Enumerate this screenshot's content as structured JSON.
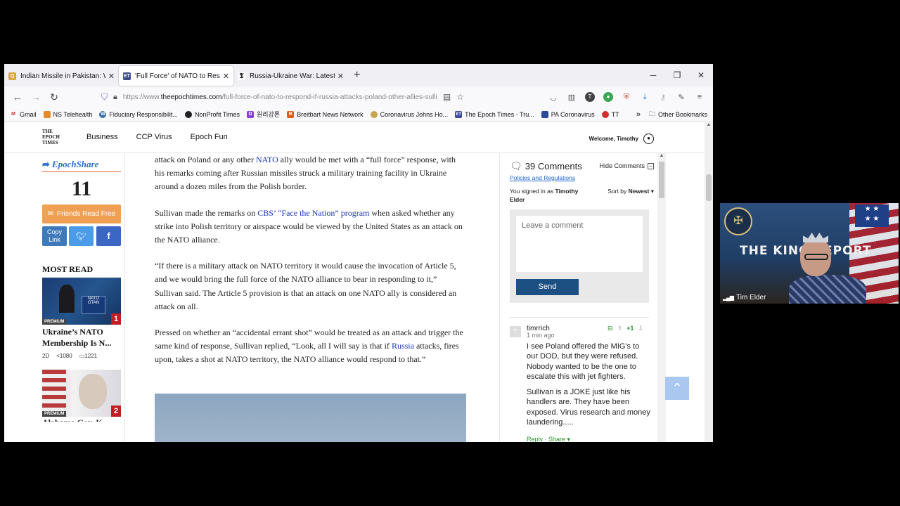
{
  "tabs": [
    {
      "title": "Indian Missile in Pakistan: What",
      "favicon_color": "#d9a441",
      "active": false
    },
    {
      "title": "'Full Force' of NATO to Respond",
      "favicon_color": "#3d4a9a",
      "active": true
    },
    {
      "title": "Russia-Ukraine War: Latest New",
      "favicon_color": "#222222",
      "active": false
    }
  ],
  "toolbar": {
    "url_prefix": "https://www.",
    "url_domain": "theepochtimes.com",
    "url_path": "/full-force-of-nato-to-respond-if-russia-attacks-poland-other-allies-sulli"
  },
  "bookmarks": [
    {
      "label": "Gmail",
      "color": "#d93025",
      "glyph": "M"
    },
    {
      "label": "NS Telehealth",
      "color": "#e58a2b",
      "glyph": ""
    },
    {
      "label": "Fiduciary Responsibilit...",
      "color": "#3b6ea5",
      "glyph": "W"
    },
    {
      "label": "NonProfit Times",
      "color": "#222222",
      "glyph": ""
    },
    {
      "label": "원리강론",
      "color": "#8a3fd1",
      "glyph": "D"
    },
    {
      "label": "Breitbart News Network",
      "color": "#e05a1c",
      "glyph": "B"
    },
    {
      "label": "Coronavirus Johns Ho...",
      "color": "#c9a34a",
      "glyph": ""
    },
    {
      "label": "The Epoch Times - Tru...",
      "color": "#3d4a9a",
      "glyph": "ET"
    },
    {
      "label": "PA Coronavirus",
      "color": "#2a4a9a",
      "glyph": ""
    },
    {
      "label": "TT",
      "color": "#d32f2f",
      "glyph": ""
    }
  ],
  "other_bookmarks": "Other Bookmarks",
  "site": {
    "logo_lines": [
      "THE",
      "EPOCH",
      "TIMES"
    ],
    "nav": [
      "Business",
      "CCP Virus",
      "Epoch Fun"
    ],
    "welcome": "Welcome, Timothy"
  },
  "sidebar": {
    "share_logo": "EpochShare",
    "share_count": "11",
    "friends_read_free": "Friends Read Free",
    "copy_link": "Copy Link",
    "most_read_heading": "MOST READ",
    "items": [
      {
        "badge": "PREMIUM",
        "rank": "1",
        "title": "Ukraine’s NATO Membership Is N...",
        "age": "2D",
        "shares": "1080",
        "comments": "1221"
      },
      {
        "badge": "PREMIUM",
        "rank": "2",
        "title": "Alabama Gov. K..."
      }
    ]
  },
  "article": {
    "p1": {
      "t1": "attack on Poland or any other ",
      "link": "NATO",
      "t2": " ally would be met with a “full force” response, with his remarks coming after Russian missiles struck a military training facility in Ukraine around a dozen miles from the Polish border."
    },
    "p2": {
      "t1": "Sullivan made the remarks on ",
      "link": "CBS’ “Face the Nation” program",
      "t2": " when asked whether any strike into Polish territory or airspace would be viewed by the United States as an attack on the NATO alliance."
    },
    "p3": "“If there is a military attack on NATO territory it would cause the invocation of Article 5, and we would bring the full force of the NATO alliance to bear in responding to it,” Sullivan said. The Article 5 provision is that an attack on one NATO ally is considered an attack on all.",
    "p4": {
      "t1": "Pressed on whether an “accidental errant shot” would be treated as an attack and trigger the same kind of response, Sullivan replied, “Look, all I will say is that if ",
      "link": "Russia",
      "t2": " attacks, fires upon, takes a shot at NATO territory, the NATO alliance would respond to that.”"
    }
  },
  "comments": {
    "count": "39 Comments",
    "hide": "Hide Comments",
    "policies": "Policies and Regulations",
    "signed_prefix": "You signed in as ",
    "signed_name": "Timothy Elder",
    "sort_prefix": "Sort by ",
    "sort_value": "Newest",
    "placeholder": "Leave a comment",
    "send": "Send",
    "items": [
      {
        "avatar": "T",
        "name": "timrrich",
        "votes": "+1",
        "time": "1 min ago",
        "p1": "I see Poland offered the MIG's to our DOD, but they were refused. Nobody wanted to be the one to escalate this with jet fighters.",
        "p2": "Sullivan is a JOKE just like his handlers are. They have been exposed. Virus research and money laundering.....",
        "reply": "Reply",
        "share": "Share"
      }
    ]
  },
  "video": {
    "title": "THE KING REPORT",
    "participant": "Tim Elder"
  }
}
